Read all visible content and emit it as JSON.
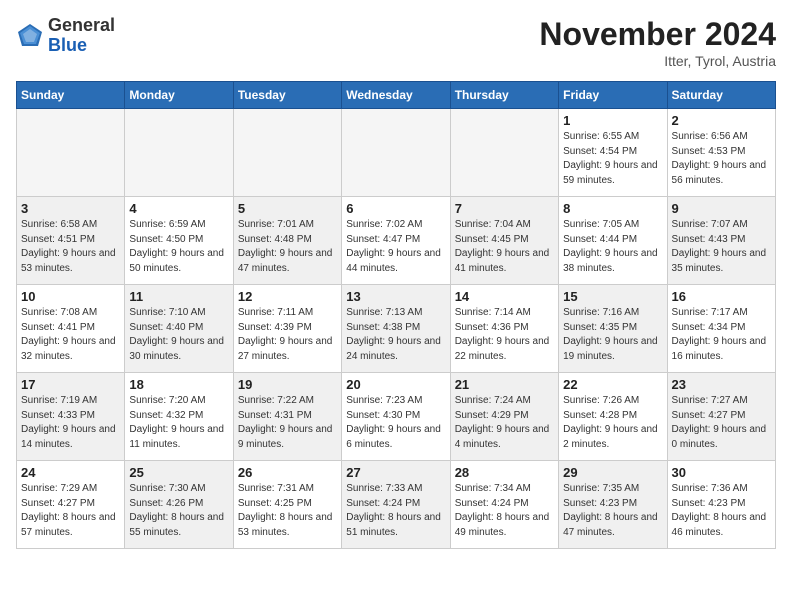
{
  "header": {
    "logo_general": "General",
    "logo_blue": "Blue",
    "month": "November 2024",
    "location": "Itter, Tyrol, Austria"
  },
  "weekdays": [
    "Sunday",
    "Monday",
    "Tuesday",
    "Wednesday",
    "Thursday",
    "Friday",
    "Saturday"
  ],
  "weeks": [
    [
      {
        "day": "",
        "info": "",
        "empty": true
      },
      {
        "day": "",
        "info": "",
        "empty": true
      },
      {
        "day": "",
        "info": "",
        "empty": true
      },
      {
        "day": "",
        "info": "",
        "empty": true
      },
      {
        "day": "",
        "info": "",
        "empty": true
      },
      {
        "day": "1",
        "info": "Sunrise: 6:55 AM\nSunset: 4:54 PM\nDaylight: 9 hours and 59 minutes."
      },
      {
        "day": "2",
        "info": "Sunrise: 6:56 AM\nSunset: 4:53 PM\nDaylight: 9 hours and 56 minutes."
      }
    ],
    [
      {
        "day": "3",
        "info": "Sunrise: 6:58 AM\nSunset: 4:51 PM\nDaylight: 9 hours and 53 minutes.",
        "shaded": true
      },
      {
        "day": "4",
        "info": "Sunrise: 6:59 AM\nSunset: 4:50 PM\nDaylight: 9 hours and 50 minutes."
      },
      {
        "day": "5",
        "info": "Sunrise: 7:01 AM\nSunset: 4:48 PM\nDaylight: 9 hours and 47 minutes.",
        "shaded": true
      },
      {
        "day": "6",
        "info": "Sunrise: 7:02 AM\nSunset: 4:47 PM\nDaylight: 9 hours and 44 minutes."
      },
      {
        "day": "7",
        "info": "Sunrise: 7:04 AM\nSunset: 4:45 PM\nDaylight: 9 hours and 41 minutes.",
        "shaded": true
      },
      {
        "day": "8",
        "info": "Sunrise: 7:05 AM\nSunset: 4:44 PM\nDaylight: 9 hours and 38 minutes."
      },
      {
        "day": "9",
        "info": "Sunrise: 7:07 AM\nSunset: 4:43 PM\nDaylight: 9 hours and 35 minutes.",
        "shaded": true
      }
    ],
    [
      {
        "day": "10",
        "info": "Sunrise: 7:08 AM\nSunset: 4:41 PM\nDaylight: 9 hours and 32 minutes."
      },
      {
        "day": "11",
        "info": "Sunrise: 7:10 AM\nSunset: 4:40 PM\nDaylight: 9 hours and 30 minutes.",
        "shaded": true
      },
      {
        "day": "12",
        "info": "Sunrise: 7:11 AM\nSunset: 4:39 PM\nDaylight: 9 hours and 27 minutes."
      },
      {
        "day": "13",
        "info": "Sunrise: 7:13 AM\nSunset: 4:38 PM\nDaylight: 9 hours and 24 minutes.",
        "shaded": true
      },
      {
        "day": "14",
        "info": "Sunrise: 7:14 AM\nSunset: 4:36 PM\nDaylight: 9 hours and 22 minutes."
      },
      {
        "day": "15",
        "info": "Sunrise: 7:16 AM\nSunset: 4:35 PM\nDaylight: 9 hours and 19 minutes.",
        "shaded": true
      },
      {
        "day": "16",
        "info": "Sunrise: 7:17 AM\nSunset: 4:34 PM\nDaylight: 9 hours and 16 minutes."
      }
    ],
    [
      {
        "day": "17",
        "info": "Sunrise: 7:19 AM\nSunset: 4:33 PM\nDaylight: 9 hours and 14 minutes.",
        "shaded": true
      },
      {
        "day": "18",
        "info": "Sunrise: 7:20 AM\nSunset: 4:32 PM\nDaylight: 9 hours and 11 minutes."
      },
      {
        "day": "19",
        "info": "Sunrise: 7:22 AM\nSunset: 4:31 PM\nDaylight: 9 hours and 9 minutes.",
        "shaded": true
      },
      {
        "day": "20",
        "info": "Sunrise: 7:23 AM\nSunset: 4:30 PM\nDaylight: 9 hours and 6 minutes."
      },
      {
        "day": "21",
        "info": "Sunrise: 7:24 AM\nSunset: 4:29 PM\nDaylight: 9 hours and 4 minutes.",
        "shaded": true
      },
      {
        "day": "22",
        "info": "Sunrise: 7:26 AM\nSunset: 4:28 PM\nDaylight: 9 hours and 2 minutes."
      },
      {
        "day": "23",
        "info": "Sunrise: 7:27 AM\nSunset: 4:27 PM\nDaylight: 9 hours and 0 minutes.",
        "shaded": true
      }
    ],
    [
      {
        "day": "24",
        "info": "Sunrise: 7:29 AM\nSunset: 4:27 PM\nDaylight: 8 hours and 57 minutes."
      },
      {
        "day": "25",
        "info": "Sunrise: 7:30 AM\nSunset: 4:26 PM\nDaylight: 8 hours and 55 minutes.",
        "shaded": true
      },
      {
        "day": "26",
        "info": "Sunrise: 7:31 AM\nSunset: 4:25 PM\nDaylight: 8 hours and 53 minutes."
      },
      {
        "day": "27",
        "info": "Sunrise: 7:33 AM\nSunset: 4:24 PM\nDaylight: 8 hours and 51 minutes.",
        "shaded": true
      },
      {
        "day": "28",
        "info": "Sunrise: 7:34 AM\nSunset: 4:24 PM\nDaylight: 8 hours and 49 minutes."
      },
      {
        "day": "29",
        "info": "Sunrise: 7:35 AM\nSunset: 4:23 PM\nDaylight: 8 hours and 47 minutes.",
        "shaded": true
      },
      {
        "day": "30",
        "info": "Sunrise: 7:36 AM\nSunset: 4:23 PM\nDaylight: 8 hours and 46 minutes."
      }
    ]
  ]
}
